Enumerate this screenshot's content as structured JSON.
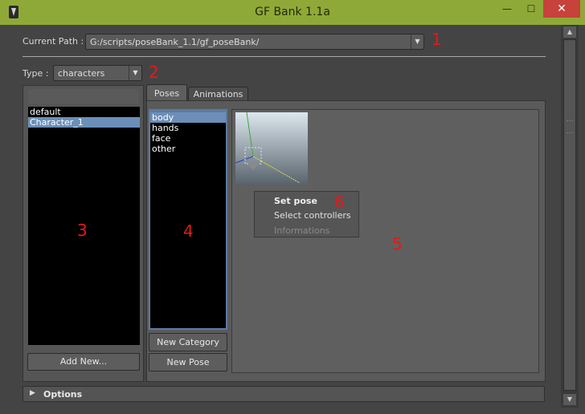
{
  "window": {
    "title": "GF Bank 1.1a",
    "minimize": "—",
    "maximize": "☐",
    "close": "✕"
  },
  "path": {
    "label": "Current Path :",
    "value": "G:/scripts/poseBank_1.1/gf_poseBank/"
  },
  "type": {
    "label": "Type :",
    "value": "characters"
  },
  "characters": {
    "items": [
      "default",
      "Character_1"
    ],
    "selected_index": 1,
    "add_button": "Add New..."
  },
  "tabs": [
    "Poses",
    "Animations"
  ],
  "categories": {
    "items": [
      "body",
      "hands",
      "face",
      "other"
    ],
    "selected_index": 0,
    "new_category_button": "New Category",
    "new_pose_button": "New Pose"
  },
  "context_menu": {
    "items": [
      "Set pose",
      "Select controllers",
      "Informations"
    ]
  },
  "options": {
    "label": "Options"
  },
  "annotations": [
    "1",
    "2",
    "3",
    "4",
    "5",
    "6"
  ]
}
